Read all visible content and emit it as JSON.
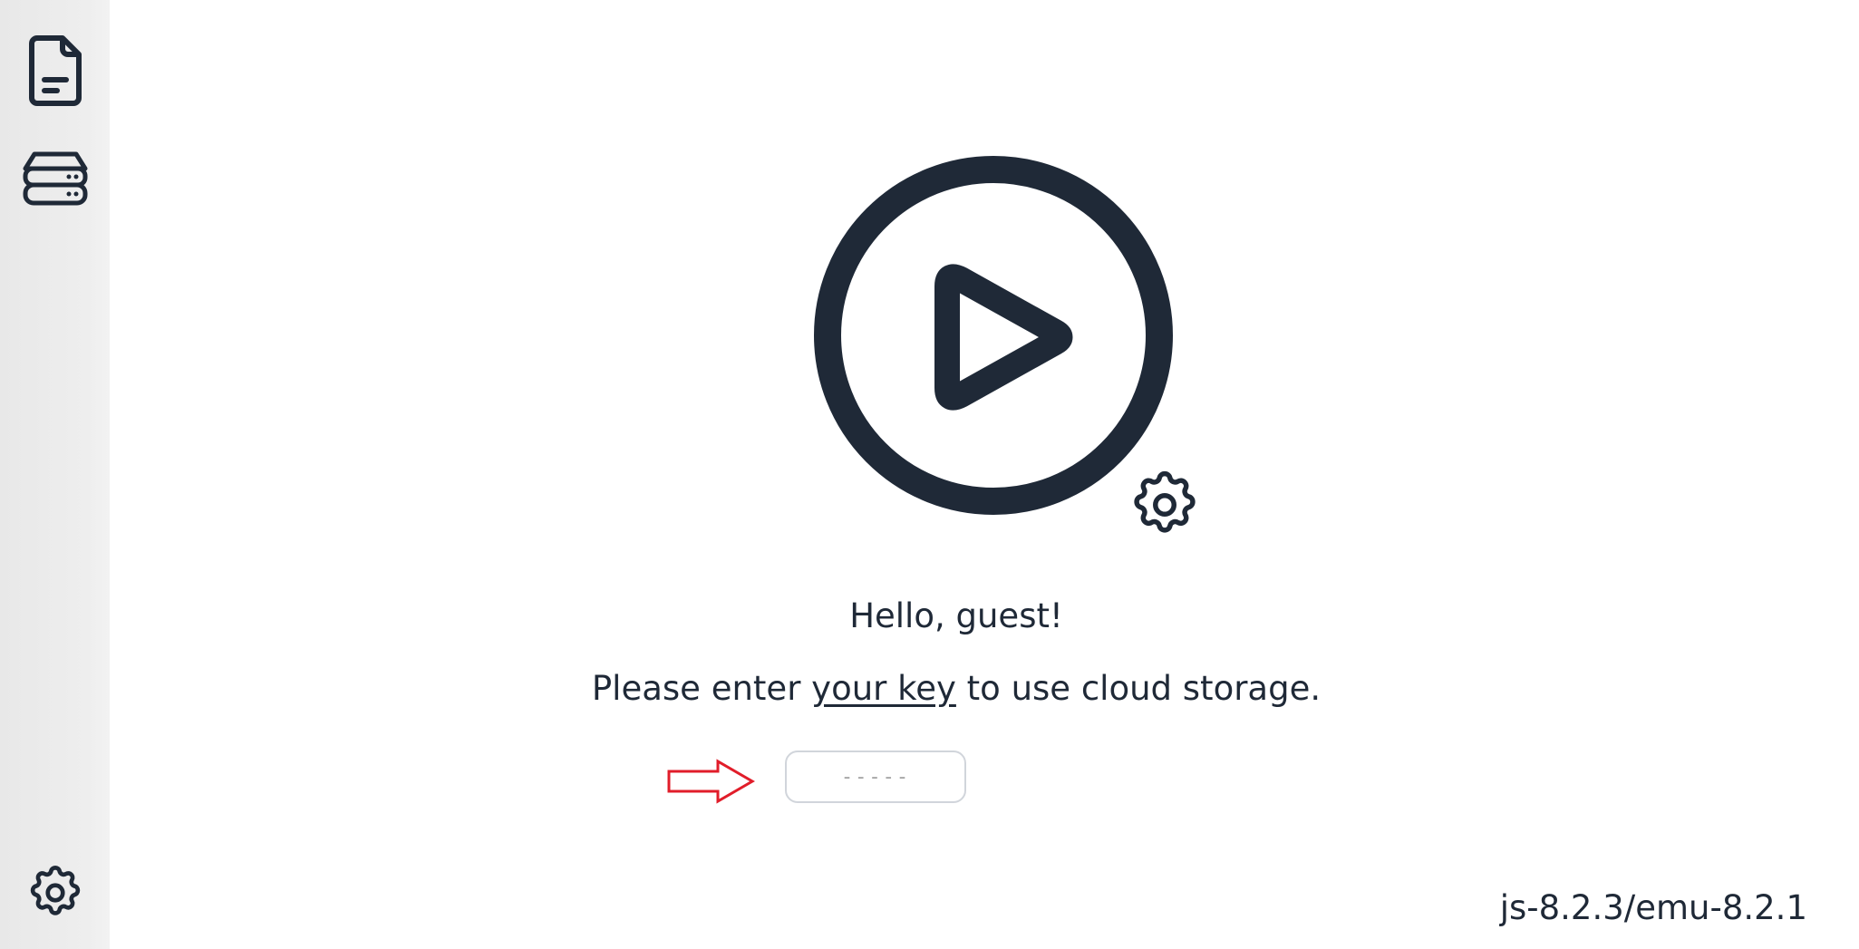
{
  "sidebar": {
    "items": [
      {
        "icon": "document-icon"
      },
      {
        "icon": "storage-icon"
      },
      {
        "icon": "gear-icon"
      }
    ]
  },
  "main": {
    "logo_icon": "play-circle-icon",
    "logo_badge_icon": "gear-icon",
    "greeting": "Hello, guest!",
    "prompt_before": "Please enter ",
    "prompt_link": "your key",
    "prompt_after": " to use cloud storage.",
    "key_input": {
      "value": "",
      "placeholder": "-----"
    },
    "arrow_icon": "arrow-right-icon",
    "arrow_color": "#e11d2a"
  },
  "footer": {
    "version": "js-8.2.3/emu-8.2.1"
  },
  "colors": {
    "ink": "#1f2937",
    "sidebar_bg": "#ebebeb",
    "input_border": "#d1d5db"
  }
}
